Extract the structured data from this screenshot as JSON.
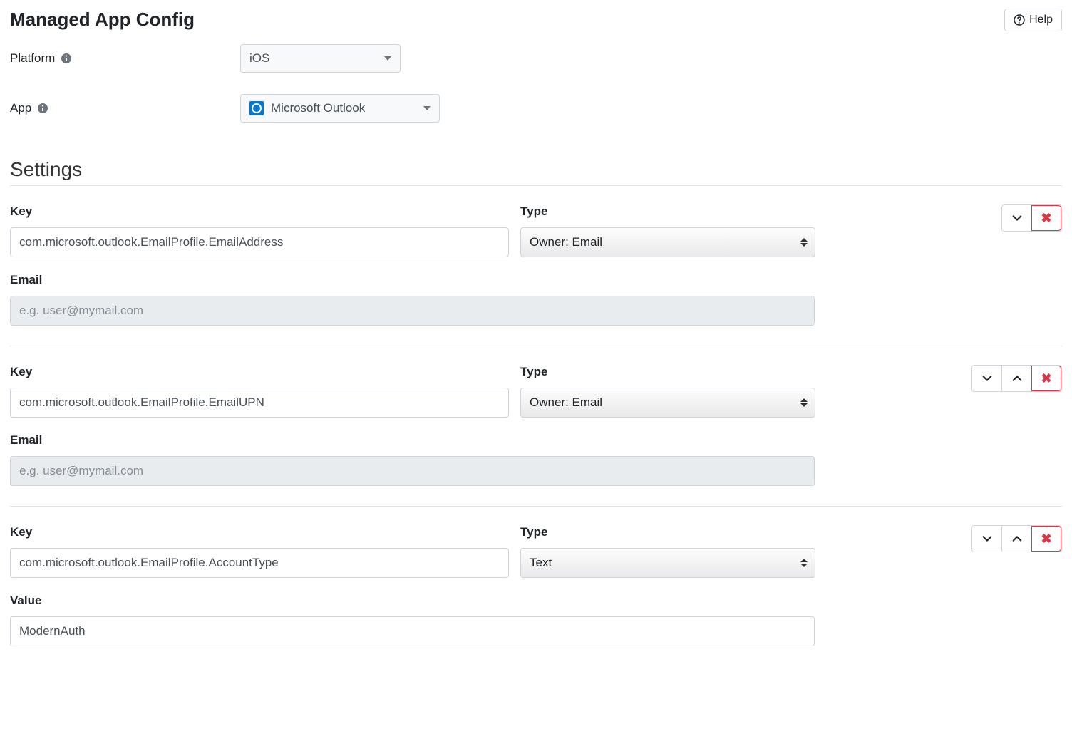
{
  "header": {
    "title": "Managed App Config",
    "help_label": "Help"
  },
  "form": {
    "platform_label": "Platform",
    "platform_value": "iOS",
    "app_label": "App",
    "app_value": "Microsoft Outlook"
  },
  "section": {
    "title": "Settings"
  },
  "labels": {
    "key": "Key",
    "type": "Type",
    "email": "Email",
    "value": "Value"
  },
  "placeholders": {
    "email": "e.g. user@mymail.com"
  },
  "settings": [
    {
      "key": "com.microsoft.outlook.EmailProfile.EmailAddress",
      "type": "Owner: Email",
      "sub_label": "Email",
      "sub_value": "",
      "sub_placeholder": "e.g. user@mymail.com",
      "sub_disabled": true,
      "has_up": false
    },
    {
      "key": "com.microsoft.outlook.EmailProfile.EmailUPN",
      "type": "Owner: Email",
      "sub_label": "Email",
      "sub_value": "",
      "sub_placeholder": "e.g. user@mymail.com",
      "sub_disabled": true,
      "has_up": true
    },
    {
      "key": "com.microsoft.outlook.EmailProfile.AccountType",
      "type": "Text",
      "sub_label": "Value",
      "sub_value": "ModernAuth",
      "sub_placeholder": "",
      "sub_disabled": false,
      "has_up": true
    }
  ]
}
